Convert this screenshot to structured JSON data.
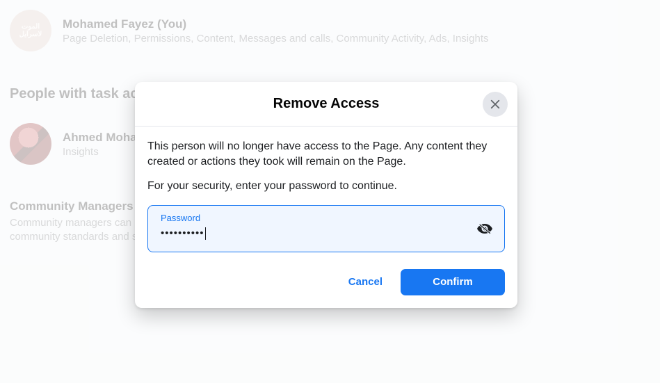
{
  "user1": {
    "name": "Mohamed Fayez (You)",
    "perms": "Page Deletion, Permissions, Content, Messages and calls, Community Activity, Ads, Insights"
  },
  "section_task_title": "People with task access",
  "user2": {
    "name": "Ahmed Mohamed",
    "perms": "Insights"
  },
  "section_cm": {
    "title": "Community Managers",
    "desc": "Community managers can moderate chat discussions, suspend or remove people who violate community standards and see all admins of this Page."
  },
  "modal": {
    "title": "Remove Access",
    "line1": "This person will no longer have access to the Page. Any content they created or actions they took will remain on the Page.",
    "line2": "For your security, enter your password to continue.",
    "password_label": "Password",
    "password_value": "••••••••••",
    "cancel": "Cancel",
    "confirm": "Confirm"
  }
}
